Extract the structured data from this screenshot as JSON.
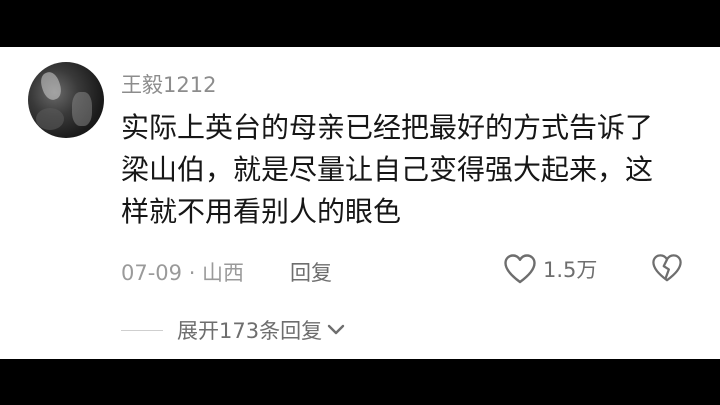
{
  "comment": {
    "username": "王毅1212",
    "text": "实际上英台的母亲已经把最好的方式告诉了梁山伯，就是尽量让自己变得强大起来，这样就不用看别人的眼色",
    "date_location": "07-09 · 山西",
    "reply_label": "回复",
    "like_count": "1.5万"
  },
  "replies": {
    "expand_label": "展开173条回复"
  },
  "icons": {
    "avatar": "user-avatar-photo",
    "like": "heart-outline-icon",
    "dislike": "broken-heart-icon",
    "expand": "chevron-down-icon"
  },
  "colors": {
    "background": "#ffffff",
    "letterbox": "#000000",
    "text": "#161616",
    "username": "#8c8c8c",
    "meta": "#9a9a9a",
    "secondary": "#6e6e6e"
  }
}
